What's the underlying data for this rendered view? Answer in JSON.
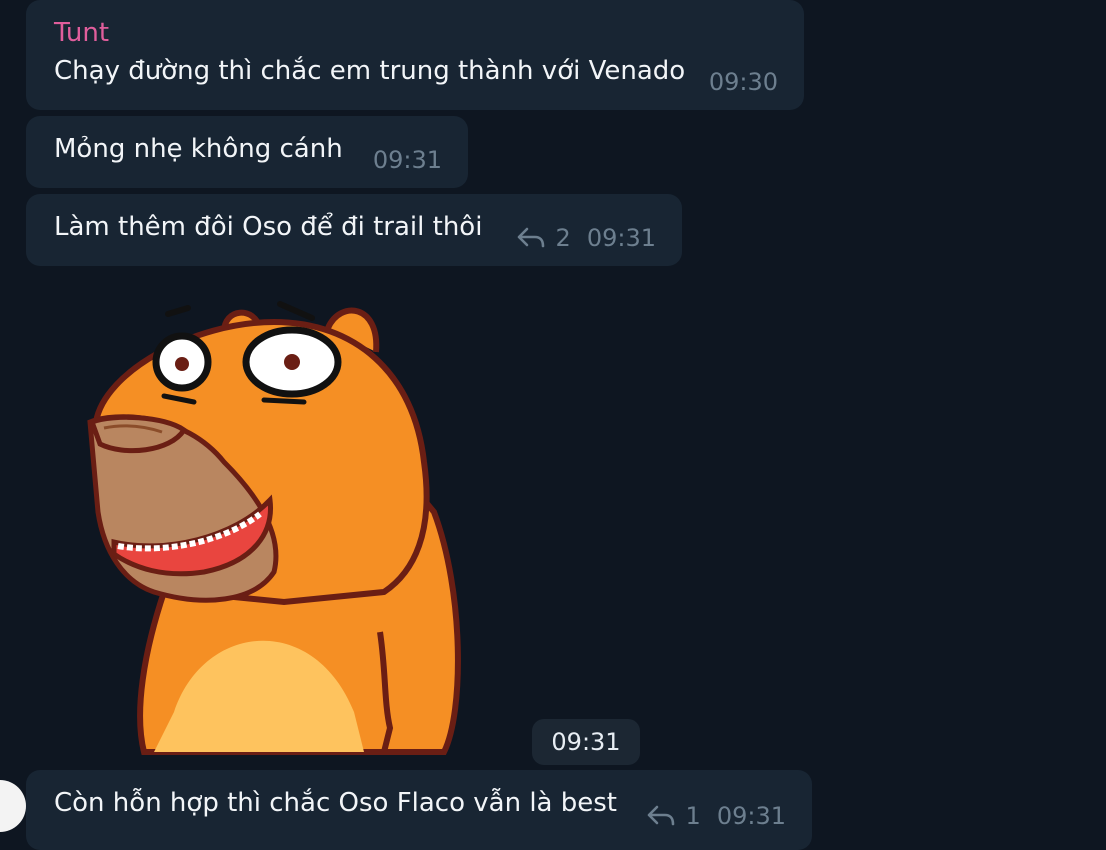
{
  "chat": {
    "messages": [
      {
        "sender": "Tunt",
        "text": "Chạy đường thì chắc em trung thành với Venado",
        "time": "09:30"
      },
      {
        "text": "Mỏng nhẹ không cánh",
        "time": "09:31"
      },
      {
        "text": "Làm thêm đôi Oso để đi trail thôi",
        "reply_count": "2",
        "time": "09:31"
      },
      {
        "sticker": "capybara-sticker",
        "time": "09:31"
      },
      {
        "text": "Còn hỗn hợp thì chắc Oso Flaco vẫn là best",
        "reply_count": "1",
        "time": "09:31"
      }
    ]
  },
  "colors": {
    "background": "#0e1621",
    "bubble": "#182533",
    "sender_name": "#e05e9c",
    "meta": "#6d7f8f"
  },
  "icons": [
    "reply-icon",
    "avatar"
  ]
}
